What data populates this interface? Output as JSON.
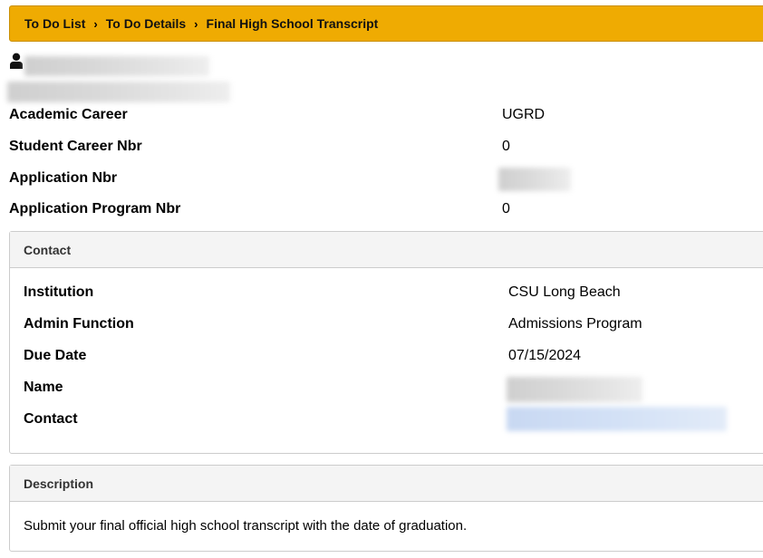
{
  "breadcrumb": {
    "items": [
      {
        "label": "To Do List"
      },
      {
        "label": "To Do Details"
      },
      {
        "label": "Final High School Transcript"
      }
    ],
    "separator": "›"
  },
  "student": {
    "fields": [
      {
        "label": "Academic Career",
        "value": "UGRD"
      },
      {
        "label": "Student Career Nbr",
        "value": "0"
      },
      {
        "label": "Application Nbr",
        "value": ""
      },
      {
        "label": "Application Program Nbr",
        "value": "0"
      }
    ]
  },
  "contact_panel": {
    "title": "Contact",
    "fields": [
      {
        "label": "Institution",
        "value": "CSU Long Beach"
      },
      {
        "label": "Admin Function",
        "value": "Admissions Program"
      },
      {
        "label": "Due Date",
        "value": "07/15/2024"
      },
      {
        "label": "Name",
        "value": ""
      },
      {
        "label": "Contact",
        "value": ""
      }
    ]
  },
  "description_panel": {
    "title": "Description",
    "text": "Submit your final official high school transcript with the date of graduation."
  },
  "colors": {
    "breadcrumb_bg": "#efab02",
    "panel_header_bg": "#f4f4f4",
    "border": "#cccccc"
  },
  "icons": {
    "person": "person-icon",
    "chevron": "chevron-right-icon"
  }
}
